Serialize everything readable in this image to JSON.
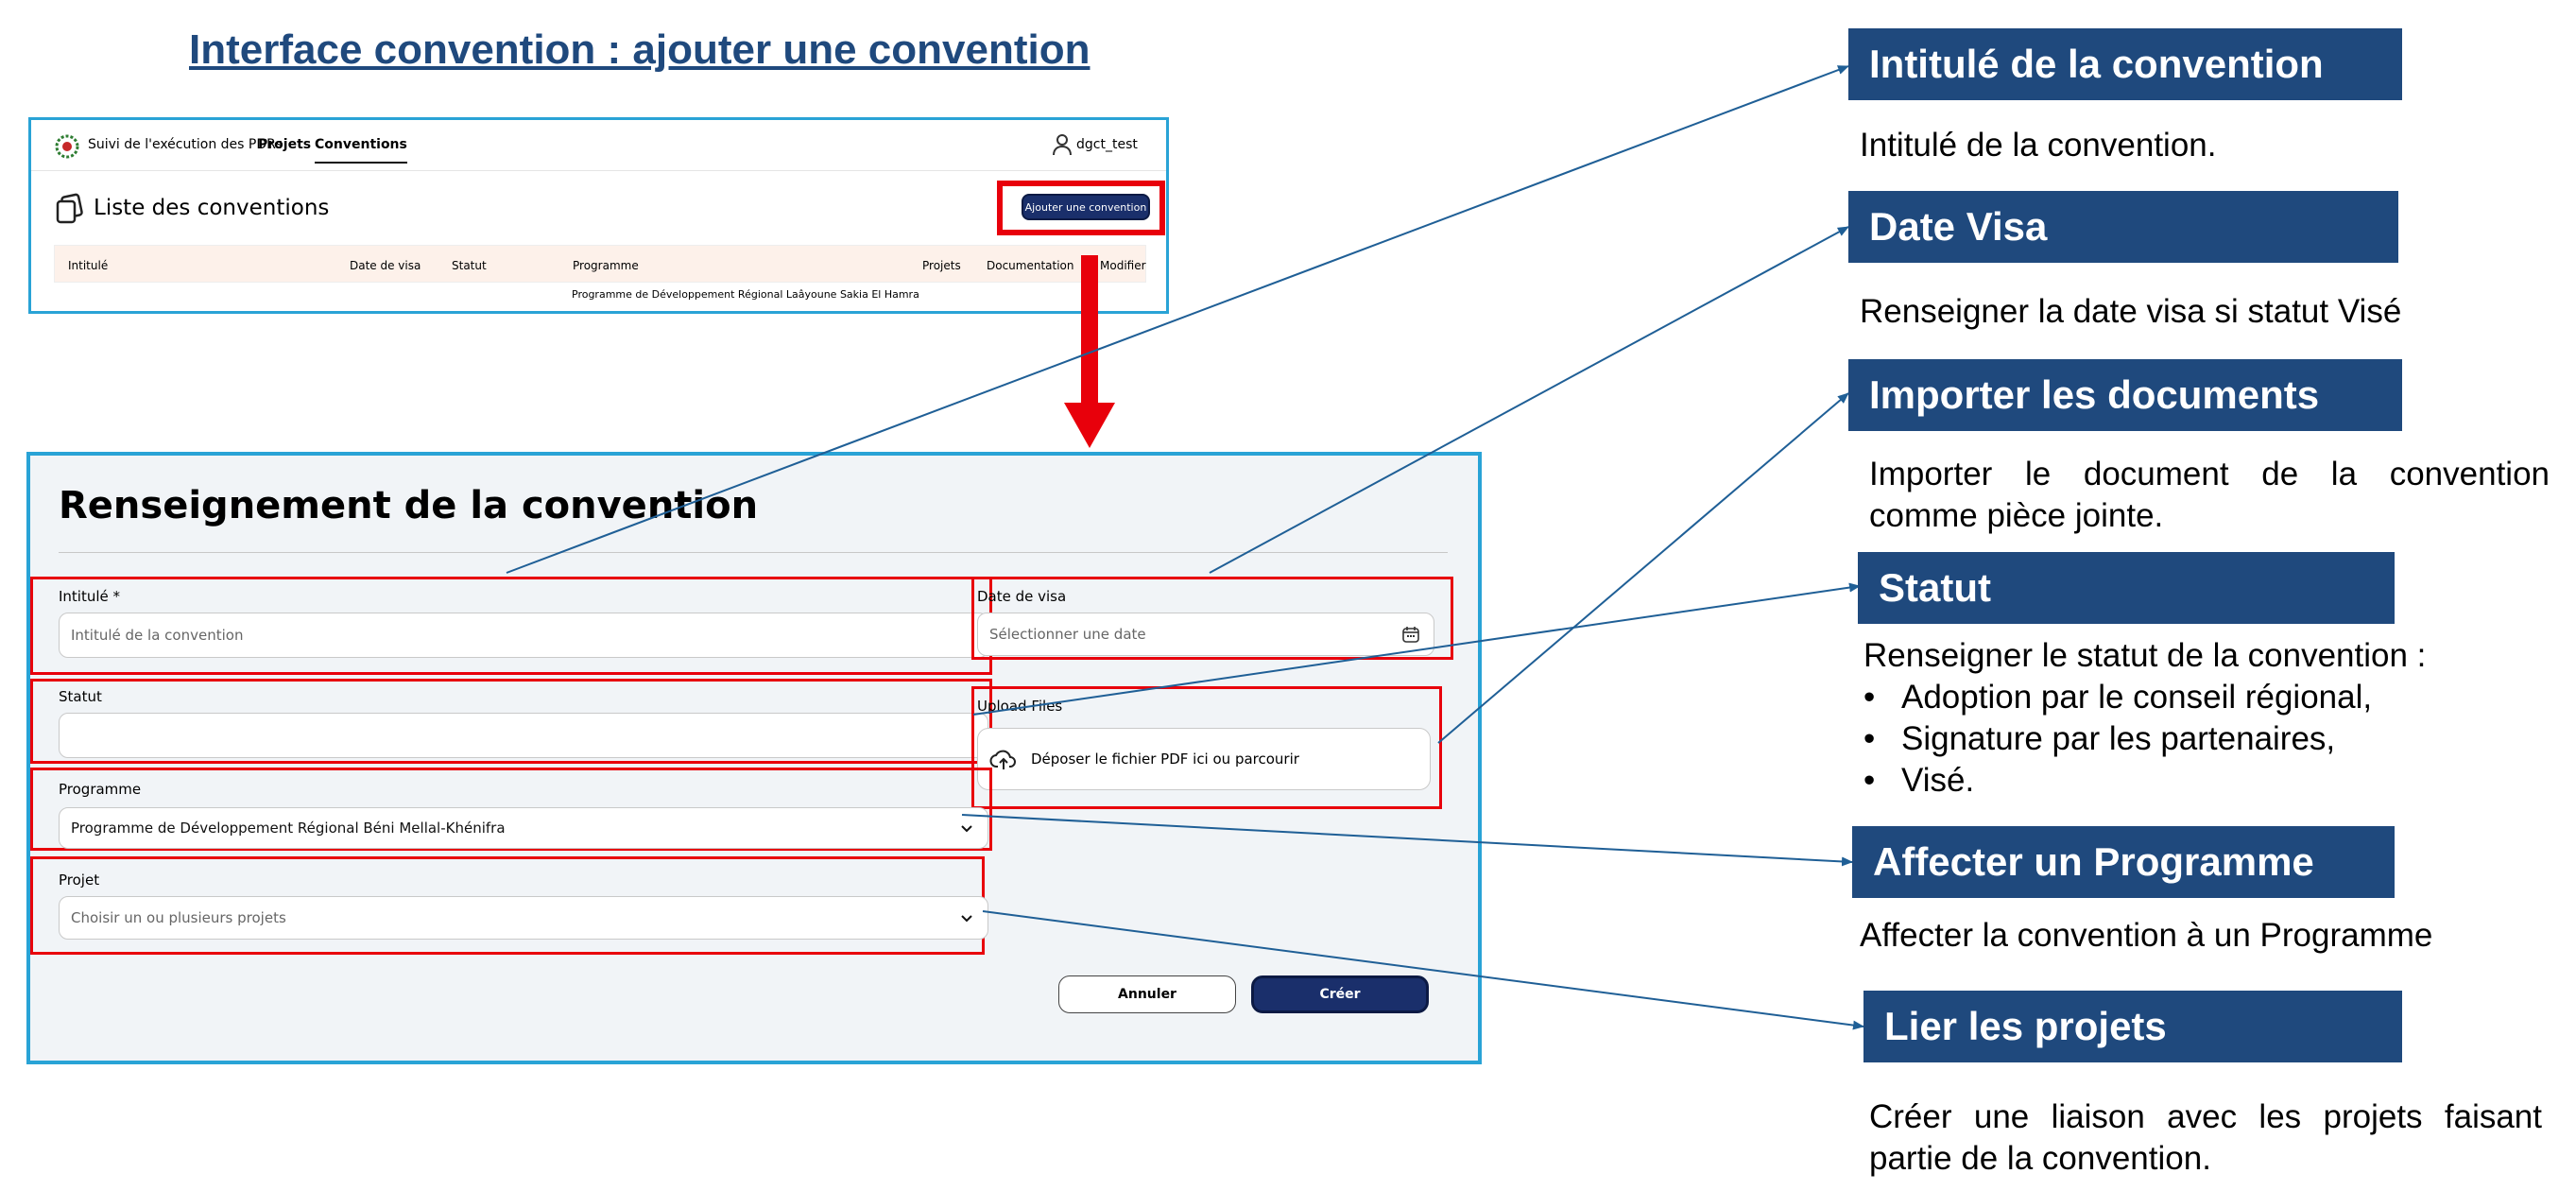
{
  "slide_title": "Interface convention : ajouter une convention",
  "app": {
    "name": "Suivi de l'exécution des PDRs",
    "nav": {
      "projets": "Projets",
      "conventions": "Conventions"
    },
    "user": "dgct_test",
    "list_title": "Liste des conventions",
    "add_button": "Ajouter une convention",
    "table": {
      "columns": [
        "Intitulé",
        "Date de visa",
        "Statut",
        "Programme",
        "Projets",
        "Documentation",
        "Modifier"
      ],
      "row_programme": "Programme de Développement Régional Laâyoune Sakia El Hamra"
    }
  },
  "form": {
    "title": "Renseignement de la convention",
    "intitule": {
      "label": "Intitulé *",
      "placeholder": "Intitulé de la convention"
    },
    "date_visa": {
      "label": "Date de visa",
      "placeholder": "Sélectionner une date"
    },
    "statut": {
      "label": "Statut",
      "value": ""
    },
    "upload": {
      "label": "Upload Files",
      "text": "Déposer le fichier PDF ici ou parcourir"
    },
    "programme": {
      "label": "Programme",
      "value": "Programme de Développement Régional Béni Mellal-Khénifra"
    },
    "projet": {
      "label": "Projet",
      "placeholder": "Choisir un ou plusieurs projets"
    },
    "cancel_button": "Annuler",
    "create_button": "Créer"
  },
  "callouts": [
    {
      "title": "Intitulé de la convention",
      "desc": "Intitulé de la convention."
    },
    {
      "title": "Date Visa",
      "desc": "Renseigner la date visa si statut Visé"
    },
    {
      "title": "Importer les documents",
      "desc_line1": "Importer le document de la convention",
      "desc_line2": "comme pièce jointe."
    },
    {
      "title": "Statut",
      "desc": "Renseigner le statut de la convention :",
      "bullets": [
        "Adoption par le conseil régional,",
        "Signature par les partenaires,",
        "Visé."
      ]
    },
    {
      "title": "Affecter un Programme",
      "desc": "Affecter la convention à un Programme"
    },
    {
      "title": "Lier les projets",
      "desc_line1": "Créer une liaison avec les projets faisant",
      "desc_line2": "partie de la convention."
    }
  ],
  "colors": {
    "callout_bg": "#1f497d",
    "highlight": "#e8000b",
    "frame": "#29a3d6",
    "primary_button": "#1a2f6b"
  }
}
